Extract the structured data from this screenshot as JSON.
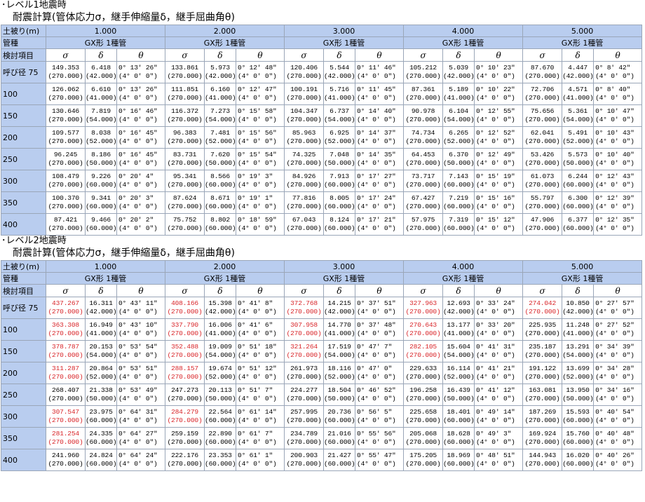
{
  "columns": {
    "cover": "土被り(m)",
    "pipe": "管種",
    "item": "検討項目",
    "sigma": "σ",
    "delta": "δ",
    "theta": "θ"
  },
  "depths": [
    "1.000",
    "2.000",
    "3.000",
    "4.000",
    "5.000"
  ],
  "pipe_type": "GX形 1種管",
  "row_labels": [
    "呼び径 75",
    "100",
    "150",
    "200",
    "250",
    "300",
    "350",
    "400"
  ],
  "level1": {
    "heading": "･レベル1地震時",
    "subheading": "耐震計算(管体応力σ，継手伸縮量δ，継手屈曲角θ)",
    "rows": [
      {
        "d": [
          {
            "s": "149.353",
            "sa": "(270.000)",
            "dl": "6.418",
            "dla": "(42.000)",
            "t": "0° 13′ 26″",
            "ta": "(4° 0′ 0″)"
          },
          {
            "s": "133.861",
            "sa": "(270.000)",
            "dl": "5.973",
            "dla": "(42.000)",
            "t": "0° 12′ 48″",
            "ta": "(4° 0′ 0″)"
          },
          {
            "s": "120.406",
            "sa": "(270.000)",
            "dl": "5.544",
            "dla": "(42.000)",
            "t": "0° 11′ 46″",
            "ta": "(4° 0′ 0″)"
          },
          {
            "s": "105.212",
            "sa": "(270.000)",
            "dl": "5.039",
            "dla": "(42.000)",
            "t": "0° 10′ 23″",
            "ta": "(4° 0′ 0″)"
          },
          {
            "s": "87.670",
            "sa": "(270.000)",
            "dl": "4.447",
            "dla": "(42.000)",
            "t": "0° 8′ 42″",
            "ta": "(4° 0′ 0″)"
          }
        ]
      },
      {
        "d": [
          {
            "s": "126.062",
            "sa": "(270.000)",
            "dl": "6.610",
            "dla": "(41.000)",
            "t": "0° 13′ 26″",
            "ta": "(4° 0′ 0″)"
          },
          {
            "s": "111.851",
            "sa": "(270.000)",
            "dl": "6.160",
            "dla": "(41.000)",
            "t": "0° 12′ 47″",
            "ta": "(4° 0′ 0″)"
          },
          {
            "s": "100.191",
            "sa": "(270.000)",
            "dl": "5.716",
            "dla": "(41.000)",
            "t": "0° 11′ 45″",
            "ta": "(4° 0′ 0″)"
          },
          {
            "s": "87.361",
            "sa": "(270.000)",
            "dl": "5.189",
            "dla": "(41.000)",
            "t": "0° 10′ 22″",
            "ta": "(4° 0′ 0″)"
          },
          {
            "s": "72.706",
            "sa": "(270.000)",
            "dl": "4.571",
            "dla": "(41.000)",
            "t": "0° 8′ 40″",
            "ta": "(4° 0′ 0″)"
          }
        ]
      },
      {
        "d": [
          {
            "s": "130.646",
            "sa": "(270.000)",
            "dl": "7.819",
            "dla": "(54.000)",
            "t": "0° 16′ 46″",
            "ta": "(4° 0′ 0″)"
          },
          {
            "s": "116.372",
            "sa": "(270.000)",
            "dl": "7.273",
            "dla": "(54.000)",
            "t": "0° 15′ 58″",
            "ta": "(4° 0′ 0″)"
          },
          {
            "s": "104.347",
            "sa": "(270.000)",
            "dl": "6.737",
            "dla": "(54.000)",
            "t": "0° 14′ 40″",
            "ta": "(4° 0′ 0″)"
          },
          {
            "s": "90.978",
            "sa": "(270.000)",
            "dl": "6.104",
            "dla": "(54.000)",
            "t": "0° 12′ 55″",
            "ta": "(4° 0′ 0″)"
          },
          {
            "s": "75.656",
            "sa": "(270.000)",
            "dl": "5.361",
            "dla": "(54.000)",
            "t": "0° 10′ 47″",
            "ta": "(4° 0′ 0″)"
          }
        ]
      },
      {
        "d": [
          {
            "s": "109.577",
            "sa": "(270.000)",
            "dl": "8.038",
            "dla": "(52.000)",
            "t": "0° 16′ 45″",
            "ta": "(4° 0′ 0″)"
          },
          {
            "s": "96.383",
            "sa": "(270.000)",
            "dl": "7.481",
            "dla": "(52.000)",
            "t": "0° 15′ 56″",
            "ta": "(4° 0′ 0″)"
          },
          {
            "s": "85.963",
            "sa": "(270.000)",
            "dl": "6.925",
            "dla": "(52.000)",
            "t": "0° 14′ 37″",
            "ta": "(4° 0′ 0″)"
          },
          {
            "s": "74.734",
            "sa": "(270.000)",
            "dl": "6.265",
            "dla": "(52.000)",
            "t": "0° 12′ 52″",
            "ta": "(4° 0′ 0″)"
          },
          {
            "s": "62.041",
            "sa": "(270.000)",
            "dl": "5.491",
            "dla": "(52.000)",
            "t": "0° 10′ 43″",
            "ta": "(4° 0′ 0″)"
          }
        ]
      },
      {
        "d": [
          {
            "s": "96.245",
            "sa": "(270.000)",
            "dl": "8.186",
            "dla": "(50.000)",
            "t": "0° 16′ 45″",
            "ta": "(4° 0′ 0″)"
          },
          {
            "s": "83.731",
            "sa": "(270.000)",
            "dl": "7.620",
            "dla": "(50.000)",
            "t": "0° 15′ 54″",
            "ta": "(4° 0′ 0″)"
          },
          {
            "s": "74.325",
            "sa": "(270.000)",
            "dl": "7.048",
            "dla": "(50.000)",
            "t": "0° 14′ 35″",
            "ta": "(4° 0′ 0″)"
          },
          {
            "s": "64.453",
            "sa": "(270.000)",
            "dl": "6.370",
            "dla": "(50.000)",
            "t": "0° 12′ 49″",
            "ta": "(4° 0′ 0″)"
          },
          {
            "s": "53.426",
            "sa": "(270.000)",
            "dl": "5.573",
            "dla": "(50.000)",
            "t": "0° 10′ 40″",
            "ta": "(4° 0′ 0″)"
          }
        ]
      },
      {
        "d": [
          {
            "s": "108.479",
            "sa": "(270.000)",
            "dl": "9.226",
            "dla": "(60.000)",
            "t": "0° 20′ 4″",
            "ta": "(4° 0′ 0″)"
          },
          {
            "s": "95.341",
            "sa": "(270.000)",
            "dl": "8.566",
            "dla": "(60.000)",
            "t": "0° 19′ 3″",
            "ta": "(4° 0′ 0″)"
          },
          {
            "s": "84.926",
            "sa": "(270.000)",
            "dl": "7.913",
            "dla": "(60.000)",
            "t": "0° 17′ 27″",
            "ta": "(4° 0′ 0″)"
          },
          {
            "s": "73.717",
            "sa": "(270.000)",
            "dl": "7.143",
            "dla": "(60.000)",
            "t": "0° 15′ 19″",
            "ta": "(4° 0′ 0″)"
          },
          {
            "s": "61.073",
            "sa": "(270.000)",
            "dl": "6.244",
            "dla": "(60.000)",
            "t": "0° 12′ 43″",
            "ta": "(4° 0′ 0″)"
          }
        ]
      },
      {
        "d": [
          {
            "s": "100.370",
            "sa": "(270.000)",
            "dl": "9.341",
            "dla": "(60.000)",
            "t": "0° 20′ 3″",
            "ta": "(4° 0′ 0″)"
          },
          {
            "s": "87.624",
            "sa": "(270.000)",
            "dl": "8.671",
            "dla": "(60.000)",
            "t": "0° 19′ 1″",
            "ta": "(4° 0′ 0″)"
          },
          {
            "s": "77.816",
            "sa": "(270.000)",
            "dl": "8.005",
            "dla": "(60.000)",
            "t": "0° 17′ 24″",
            "ta": "(4° 0′ 0″)"
          },
          {
            "s": "67.427",
            "sa": "(270.000)",
            "dl": "7.219",
            "dla": "(60.000)",
            "t": "0° 15′ 16″",
            "ta": "(4° 0′ 0″)"
          },
          {
            "s": "55.797",
            "sa": "(270.000)",
            "dl": "6.300",
            "dla": "(60.000)",
            "t": "0° 12′ 39″",
            "ta": "(4° 0′ 0″)"
          }
        ]
      },
      {
        "d": [
          {
            "s": "87.421",
            "sa": "(270.000)",
            "dl": "9.466",
            "dla": "(60.000)",
            "t": "0° 20′ 2″",
            "ta": "(4° 0′ 0″)"
          },
          {
            "s": "75.752",
            "sa": "(270.000)",
            "dl": "8.802",
            "dla": "(60.000)",
            "t": "0° 18′ 59″",
            "ta": "(4° 0′ 0″)"
          },
          {
            "s": "67.043",
            "sa": "(270.000)",
            "dl": "8.124",
            "dla": "(60.000)",
            "t": "0° 17′ 21″",
            "ta": "(4° 0′ 0″)"
          },
          {
            "s": "57.975",
            "sa": "(270.000)",
            "dl": "7.319",
            "dla": "(60.000)",
            "t": "0° 15′ 12″",
            "ta": "(4° 0′ 0″)"
          },
          {
            "s": "47.906",
            "sa": "(270.000)",
            "dl": "6.377",
            "dla": "(60.000)",
            "t": "0° 12′ 35″",
            "ta": "(4° 0′ 0″)"
          }
        ]
      }
    ]
  },
  "level2": {
    "heading": "･レベル2地震時",
    "subheading": "耐震計算(管体応力σ，継手伸縮量δ，継手屈曲角θ)",
    "rows": [
      {
        "d": [
          {
            "s": "437.267",
            "sa": "(270.000)",
            "red": true,
            "dl": "16.311",
            "dla": "(42.000)",
            "t": "0° 43′ 11″",
            "ta": "(4° 0′ 0″)"
          },
          {
            "s": "408.166",
            "sa": "(270.000)",
            "red": true,
            "dl": "15.398",
            "dla": "(42.000)",
            "t": "0° 41′ 8″",
            "ta": "(4° 0′ 0″)"
          },
          {
            "s": "372.768",
            "sa": "(270.000)",
            "red": true,
            "dl": "14.215",
            "dla": "(42.000)",
            "t": "0° 37′ 51″",
            "ta": "(4° 0′ 0″)"
          },
          {
            "s": "327.963",
            "sa": "(270.000)",
            "red": true,
            "dl": "12.693",
            "dla": "(42.000)",
            "t": "0° 33′ 24″",
            "ta": "(4° 0′ 0″)"
          },
          {
            "s": "274.042",
            "sa": "(270.000)",
            "red": true,
            "dl": "10.850",
            "dla": "(42.000)",
            "t": "0° 27′ 57″",
            "ta": "(4° 0′ 0″)"
          }
        ]
      },
      {
        "d": [
          {
            "s": "363.308",
            "sa": "(270.000)",
            "red": true,
            "dl": "16.949",
            "dla": "(41.000)",
            "t": "0° 43′ 10″",
            "ta": "(4° 0′ 0″)"
          },
          {
            "s": "337.790",
            "sa": "(270.000)",
            "red": true,
            "dl": "16.006",
            "dla": "(41.000)",
            "t": "0° 41′ 6″",
            "ta": "(4° 0′ 0″)"
          },
          {
            "s": "307.958",
            "sa": "(270.000)",
            "red": true,
            "dl": "14.770",
            "dla": "(41.000)",
            "t": "0° 37′ 48″",
            "ta": "(4° 0′ 0″)"
          },
          {
            "s": "270.643",
            "sa": "(270.000)",
            "red": true,
            "dl": "13.177",
            "dla": "(41.000)",
            "t": "0° 33′ 20″",
            "ta": "(4° 0′ 0″)"
          },
          {
            "s": "225.935",
            "sa": "(270.000)",
            "red": false,
            "dl": "11.248",
            "dla": "(41.000)",
            "t": "0° 27′ 52″",
            "ta": "(4° 0′ 0″)"
          }
        ]
      },
      {
        "d": [
          {
            "s": "378.787",
            "sa": "(270.000)",
            "red": true,
            "dl": "20.153",
            "dla": "(54.000)",
            "t": "0° 53′ 54″",
            "ta": "(4° 0′ 0″)"
          },
          {
            "s": "352.488",
            "sa": "(270.000)",
            "red": true,
            "dl": "19.009",
            "dla": "(54.000)",
            "t": "0° 51′ 18″",
            "ta": "(4° 0′ 0″)"
          },
          {
            "s": "321.264",
            "sa": "(270.000)",
            "red": true,
            "dl": "17.519",
            "dla": "(54.000)",
            "t": "0° 47′ 7″",
            "ta": "(4° 0′ 0″)"
          },
          {
            "s": "282.105",
            "sa": "(270.000)",
            "red": true,
            "dl": "15.604",
            "dla": "(54.000)",
            "t": "0° 41′ 31″",
            "ta": "(4° 0′ 0″)"
          },
          {
            "s": "235.187",
            "sa": "(270.000)",
            "red": false,
            "dl": "13.291",
            "dla": "(54.000)",
            "t": "0° 34′ 39″",
            "ta": "(4° 0′ 0″)"
          }
        ]
      },
      {
        "d": [
          {
            "s": "311.287",
            "sa": "(270.000)",
            "red": true,
            "dl": "20.864",
            "dla": "(52.000)",
            "t": "0° 53′ 51″",
            "ta": "(4° 0′ 0″)"
          },
          {
            "s": "288.157",
            "sa": "(270.000)",
            "red": true,
            "dl": "19.674",
            "dla": "(52.000)",
            "t": "0° 51′ 12″",
            "ta": "(4° 0′ 0″)"
          },
          {
            "s": "261.973",
            "sa": "(270.000)",
            "red": false,
            "dl": "18.116",
            "dla": "(52.000)",
            "t": "0° 47′ 0″",
            "ta": "(4° 0′ 0″)"
          },
          {
            "s": "229.633",
            "sa": "(270.000)",
            "red": false,
            "dl": "16.114",
            "dla": "(52.000)",
            "t": "0° 41′ 21″",
            "ta": "(4° 0′ 0″)"
          },
          {
            "s": "191.122",
            "sa": "(270.000)",
            "red": false,
            "dl": "13.699",
            "dla": "(52.000)",
            "t": "0° 34′ 28″",
            "ta": "(4° 0′ 0″)"
          }
        ]
      },
      {
        "d": [
          {
            "s": "268.407",
            "sa": "(270.000)",
            "red": false,
            "dl": "21.338",
            "dla": "(50.000)",
            "t": "0° 53′ 49″",
            "ta": "(4° 0′ 0″)"
          },
          {
            "s": "247.273",
            "sa": "(270.000)",
            "red": false,
            "dl": "20.113",
            "dla": "(50.000)",
            "t": "0° 51′ 7″",
            "ta": "(4° 0′ 0″)"
          },
          {
            "s": "224.277",
            "sa": "(270.000)",
            "red": false,
            "dl": "18.504",
            "dla": "(50.000)",
            "t": "0° 46′ 52″",
            "ta": "(4° 0′ 0″)"
          },
          {
            "s": "196.258",
            "sa": "(270.000)",
            "red": false,
            "dl": "16.439",
            "dla": "(50.000)",
            "t": "0° 41′ 12″",
            "ta": "(4° 0′ 0″)"
          },
          {
            "s": "163.081",
            "sa": "(270.000)",
            "red": false,
            "dl": "13.950",
            "dla": "(50.000)",
            "t": "0° 34′ 16″",
            "ta": "(4° 0′ 0″)"
          }
        ]
      },
      {
        "d": [
          {
            "s": "307.547",
            "sa": "(270.000)",
            "red": true,
            "dl": "23.975",
            "dla": "(60.000)",
            "t": "0° 64′ 31″",
            "ta": "(4° 0′ 0″)"
          },
          {
            "s": "284.279",
            "sa": "(270.000)",
            "red": true,
            "dl": "22.564",
            "dla": "(60.000)",
            "t": "0° 61′ 14″",
            "ta": "(4° 0′ 0″)"
          },
          {
            "s": "257.995",
            "sa": "(270.000)",
            "red": false,
            "dl": "20.736",
            "dla": "(60.000)",
            "t": "0° 56′ 5″",
            "ta": "(4° 0′ 0″)"
          },
          {
            "s": "225.658",
            "sa": "(270.000)",
            "red": false,
            "dl": "18.401",
            "dla": "(60.000)",
            "t": "0° 49′ 14″",
            "ta": "(4° 0′ 0″)"
          },
          {
            "s": "187.269",
            "sa": "(270.000)",
            "red": false,
            "dl": "15.593",
            "dla": "(60.000)",
            "t": "0° 40′ 54″",
            "ta": "(4° 0′ 0″)"
          }
        ]
      },
      {
        "d": [
          {
            "s": "281.254",
            "sa": "(270.000)",
            "red": true,
            "dl": "24.335",
            "dla": "(60.000)",
            "t": "0° 64′ 27″",
            "ta": "(4° 0′ 0″)"
          },
          {
            "s": "259.159",
            "sa": "(270.000)",
            "red": false,
            "dl": "22.890",
            "dla": "(60.000)",
            "t": "0° 61′ 7″",
            "ta": "(4° 0′ 0″)"
          },
          {
            "s": "234.789",
            "sa": "(270.000)",
            "red": false,
            "dl": "21.016",
            "dla": "(60.000)",
            "t": "0° 55′ 56″",
            "ta": "(4° 0′ 0″)"
          },
          {
            "s": "205.068",
            "sa": "(270.000)",
            "red": false,
            "dl": "18.628",
            "dla": "(60.000)",
            "t": "0° 49′ 3″",
            "ta": "(4° 0′ 0″)"
          },
          {
            "s": "169.924",
            "sa": "(270.000)",
            "red": false,
            "dl": "15.760",
            "dla": "(60.000)",
            "t": "0° 40′ 48″",
            "ta": "(4° 0′ 0″)"
          }
        ]
      },
      {
        "d": [
          {
            "s": "241.960",
            "sa": "(270.000)",
            "red": false,
            "dl": "24.824",
            "dla": "(60.000)",
            "t": "0° 64′ 24″",
            "ta": "(4° 0′ 0″)"
          },
          {
            "s": "222.176",
            "sa": "(270.000)",
            "red": false,
            "dl": "23.353",
            "dla": "(60.000)",
            "t": "0° 61′ 1″",
            "ta": "(4° 0′ 0″)"
          },
          {
            "s": "200.903",
            "sa": "(270.000)",
            "red": false,
            "dl": "21.427",
            "dla": "(60.000)",
            "t": "0° 55′ 47″",
            "ta": "(4° 0′ 0″)"
          },
          {
            "s": "175.205",
            "sa": "(270.000)",
            "red": false,
            "dl": "18.969",
            "dla": "(60.000)",
            "t": "0° 48′ 51″",
            "ta": "(4° 0′ 0″)"
          },
          {
            "s": "144.943",
            "sa": "(270.000)",
            "red": false,
            "dl": "16.020",
            "dla": "(60.000)",
            "t": "0° 40′ 26″",
            "ta": "(4° 0′ 0″)"
          }
        ]
      }
    ]
  }
}
